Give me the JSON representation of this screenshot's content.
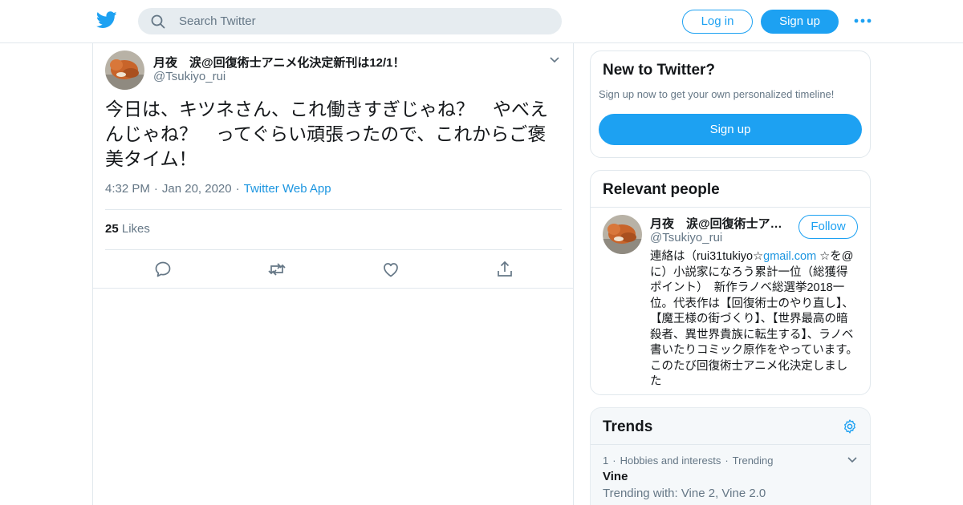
{
  "header": {
    "logo_icon": "twitter-bird-icon",
    "search_placeholder": "Search Twitter",
    "login_label": "Log in",
    "signup_label": "Sign up",
    "more_icon": "more-dots-icon",
    "accent_color": "#1da1f2"
  },
  "tweet": {
    "author_name": "月夜　涙@回復術士アニメ化決定新刊は12/1！",
    "author_handle": "@Tsukiyo_rui",
    "text": "今日は、キツネさん、これ働きすぎじゃね？　やべえんじゃね？　ってぐらい頑張ったので、これからご褒美タイム！",
    "time": "4:32 PM",
    "date": "Jan 20, 2020",
    "source": "Twitter Web App",
    "likes_count": "25",
    "likes_label": "Likes",
    "actions": [
      "reply-icon",
      "retweet-icon",
      "like-icon",
      "share-icon"
    ]
  },
  "new_to_twitter": {
    "title": "New to Twitter?",
    "subtitle": "Sign up now to get your own personalized timeline!",
    "button_label": "Sign up"
  },
  "relevant_people": {
    "title": "Relevant people",
    "person": {
      "name": "月夜　涙@回復術士ア…",
      "handle": "@Tsukiyo_rui",
      "follow_label": "Follow",
      "bio_before": "連絡は（rui31tukiyo☆",
      "bio_link": "gmail.com",
      "bio_after": " ☆を@に）小説家になろう累計一位（総獲得ポイント）　新作ラノベ総選挙2018一位。代表作は【回復術士のやり直し】、【魔王様の街づくり】、【世界最高の暗殺者、異世界貴族に転生する】、ラノベ書いたりコミック原作をやっています。このたび回復術士アニメ化決定しました"
    }
  },
  "trends": {
    "title": "Trends",
    "items": [
      {
        "rank": "1",
        "category": "Hobbies and interests",
        "status": "Trending",
        "name": "Vine",
        "trending_with": "Trending with: Vine 2, Vine 2.0"
      }
    ]
  }
}
